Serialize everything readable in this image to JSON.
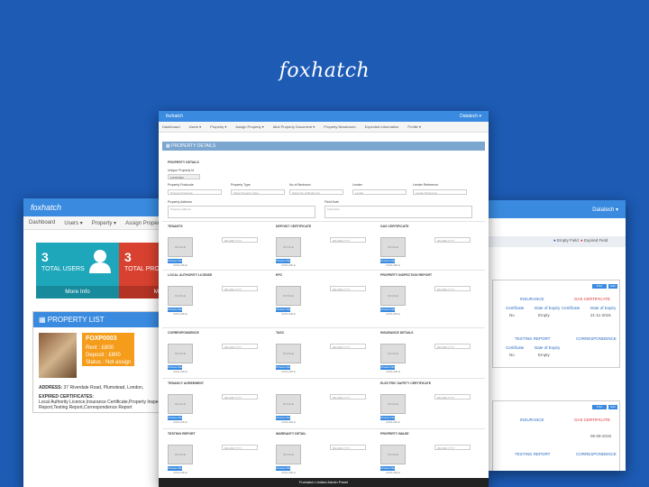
{
  "brand": "foxhatch",
  "back": {
    "logo": "foxhatch",
    "nav": [
      "Dashboard",
      "Users ▾",
      "Property ▾",
      "Assign Property ▾"
    ],
    "tiles": [
      {
        "num": "3",
        "label": "TOTAL USERS",
        "more": "More Info",
        "color": "#1ea6bb",
        "footer_color": "#178a9c"
      },
      {
        "num": "3",
        "label": "TOTAL PROPERTY",
        "more": "More",
        "color": "#d8412f",
        "footer_color": "#b33324"
      }
    ],
    "list_title": "PROPERTY LIST",
    "property": {
      "id": "FOXP0003",
      "rent": "Rent : £800",
      "deposit": "Deposit : £800",
      "status": "Status : Not assign",
      "address_label": "ADDRESS:",
      "address": "37 Riverdale Road, Plumstead, London,",
      "cert_title": "EXPIRED CERTIFICATES:",
      "certs": "Local Authority Licence,Insurance Certificate,Property Inspection Report,Testing Report,Correspondence Report"
    }
  },
  "right": {
    "user": "Datatech ▾",
    "legend_empty": "Empty Field",
    "legend_expired": "Expired Field",
    "card1": {
      "h1": "INSURANCE",
      "h2": "GAS CERTIFICATE",
      "c1": "Certificate",
      "c2": "Date of Expiry",
      "v1": "No",
      "v2": "Empty",
      "v3": "21-11-2016",
      "h3": "TESTING REPORT",
      "h4": "CORRESPONDENCE"
    },
    "card2": {
      "h1": "INSURANCE",
      "h2": "GAS CERTIFICATE",
      "v3": "06-06-2016",
      "h3": "TESTING REPORT",
      "h4": "CORRESPONDENCE"
    }
  },
  "front": {
    "logo": "foxhatch",
    "user": "Datatech ▾",
    "nav": [
      "Dashboard",
      "Users ▾",
      "Property ▾",
      "Assign Property ▾",
      "Allot Property Document ▾",
      "Property Newsroom",
      "Expected Information",
      "Profile ▾"
    ],
    "title": "PROPERTY DETAILS",
    "section": "PROPERTY DETAILS",
    "unique_id_label": "Unique Property Id",
    "unique_id": "FOXP0004",
    "fields": [
      "Property Postcode",
      "Property Type",
      "No of Bedroom",
      "Lender",
      "Lender Reference"
    ],
    "placeholders": [
      "Property Postcode",
      "Select Property Type",
      "Select No of Bedrooms",
      "Lender",
      "Lender Reference"
    ],
    "address_label": "Property Address",
    "address_ph": "Property Address",
    "note_label": "Field Note",
    "note_ph": "Field Note",
    "rows": [
      [
        "TENANTS",
        "DEPOSIT CERTIFICATE",
        "GAS CERTIFICATE"
      ],
      [
        "LOCAL AUTHORITY LICENSE",
        "EPC",
        "PROPERTY INSPECTION REPORT"
      ],
      [
        "CORRESPONDENCE",
        "TASC",
        "INSURANCE DETAILS"
      ],
      [
        "TENANCY AGREEMENT",
        "",
        "ELECTRIC SAFETY CERTIFICATE"
      ],
      [
        "TESTING REPORT",
        "WARRANTY DETAIL",
        "PROPERTY IMAGE"
      ]
    ],
    "no_file": "NO FILE AVAILABLE",
    "choose": "Choose File",
    "date_ph": "DD-MM-YYYY",
    "footer": "Foxhatch Limited Admin Panel",
    "footer_right": "Admin Panel"
  }
}
